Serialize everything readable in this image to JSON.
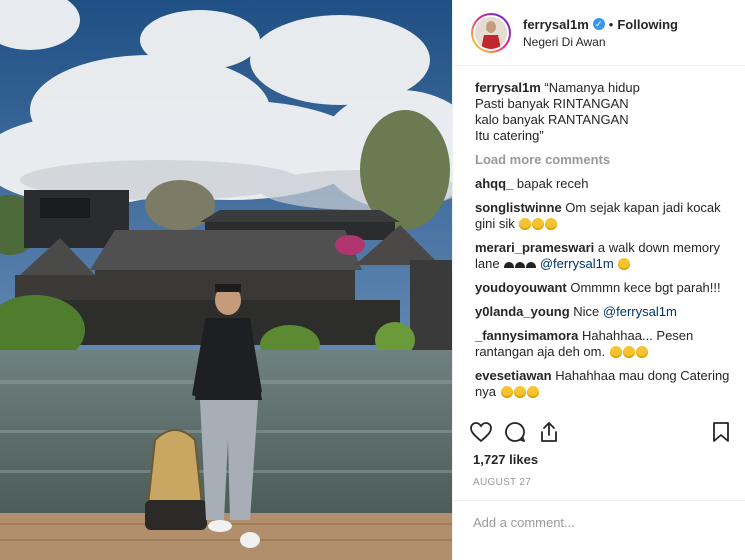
{
  "post": {
    "username": "ferrysal1m",
    "verified_icon": "verified-check-icon",
    "separator": "•",
    "follow_status": "Following",
    "location": "Negeri Di Awan"
  },
  "caption": {
    "user": "ferrysal1m",
    "text": "“Namanya hidup\nPasti banyak RINTANGAN\nkalo banyak RANTANGAN\nItu catering”"
  },
  "load_more": "Load more comments",
  "comments": [
    {
      "user": "ahqq_",
      "text": "bapak receh"
    },
    {
      "user": "songlistwinne",
      "text": "Om sejak kapan jadi kocak gini sik"
    },
    {
      "user": "merari_prameswari",
      "text": "a walk down memory lane",
      "mention": "@ferrysal1m"
    },
    {
      "user": "youdoyouwant",
      "text": "Ommmn kece bgt parah!!!"
    },
    {
      "user": "y0landa_young",
      "text": "Nice",
      "mention": "@ferrysal1m"
    },
    {
      "user": "_fannysimamora",
      "text": "Hahahhaa... Pesen rantangan aja deh om."
    },
    {
      "user": "evesetiawan",
      "text": "Hahahhaa mau dong Catering nya"
    }
  ],
  "actions": {
    "like": "heart-icon",
    "comment": "comment-bubble-icon",
    "share": "share-icon",
    "save": "bookmark-icon"
  },
  "likes": "1,727 likes",
  "date": "AUGUST 27",
  "add_comment_placeholder": "Add a comment...",
  "colors": {
    "link": "#003569",
    "muted": "#999999",
    "verified": "#3897f0"
  }
}
